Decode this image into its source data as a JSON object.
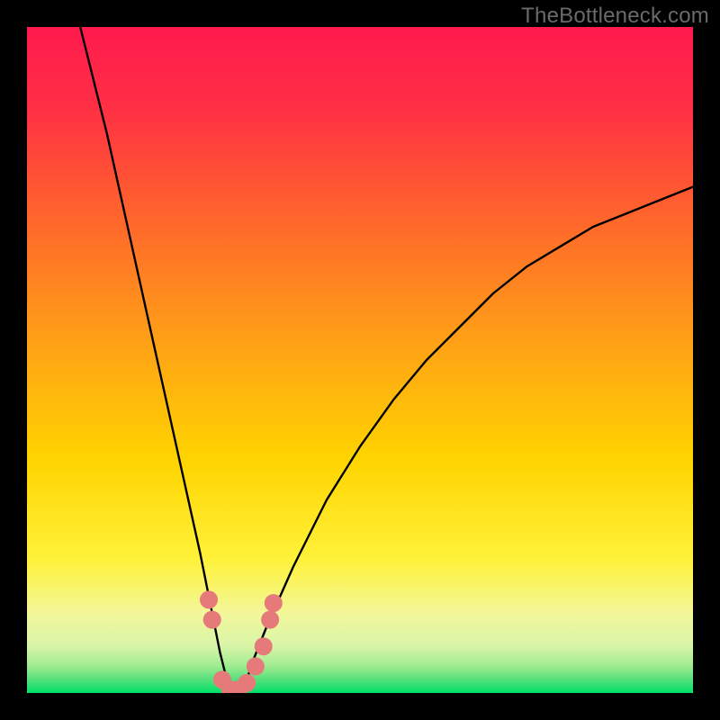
{
  "watermark": "TheBottleneck.com",
  "chart_data": {
    "type": "line",
    "title": "",
    "xlabel": "",
    "ylabel": "",
    "xlim": [
      0,
      100
    ],
    "ylim": [
      0,
      100
    ],
    "grid": false,
    "background_gradient": {
      "top_color": "#ff1a4e",
      "mid_color": "#ffd400",
      "bottom_edge_color": "#00e36b"
    },
    "series": [
      {
        "name": "bottleneck-curve",
        "x": [
          8,
          10,
          12,
          14,
          16,
          18,
          20,
          22,
          24,
          26,
          27,
          28,
          29,
          30,
          31,
          32,
          33,
          34,
          36,
          40,
          45,
          50,
          55,
          60,
          65,
          70,
          75,
          80,
          85,
          90,
          95,
          100
        ],
        "y": [
          100,
          92,
          84,
          75,
          66,
          57,
          48,
          39,
          30,
          21,
          16,
          11,
          6,
          2,
          0,
          0,
          2,
          5,
          10,
          19,
          29,
          37,
          44,
          50,
          55,
          60,
          64,
          67,
          70,
          72,
          74,
          76
        ]
      }
    ],
    "markers": [
      {
        "name": "marker-left-1",
        "x": 27.3,
        "y": 14.0
      },
      {
        "name": "marker-left-2",
        "x": 27.8,
        "y": 11.0
      },
      {
        "name": "marker-bottom-1",
        "x": 29.3,
        "y": 2.0
      },
      {
        "name": "marker-bottom-2",
        "x": 30.5,
        "y": 0.5
      },
      {
        "name": "marker-bottom-3",
        "x": 31.7,
        "y": 0.5
      },
      {
        "name": "marker-bottom-4",
        "x": 33.0,
        "y": 1.5
      },
      {
        "name": "marker-bottom-5",
        "x": 34.3,
        "y": 4.0
      },
      {
        "name": "marker-bottom-6",
        "x": 35.5,
        "y": 7.0
      },
      {
        "name": "marker-right-1",
        "x": 36.5,
        "y": 11.0
      },
      {
        "name": "marker-right-2",
        "x": 37.0,
        "y": 13.5
      }
    ],
    "marker_style": {
      "fill": "#e67a7a",
      "radius_px": 10
    }
  }
}
